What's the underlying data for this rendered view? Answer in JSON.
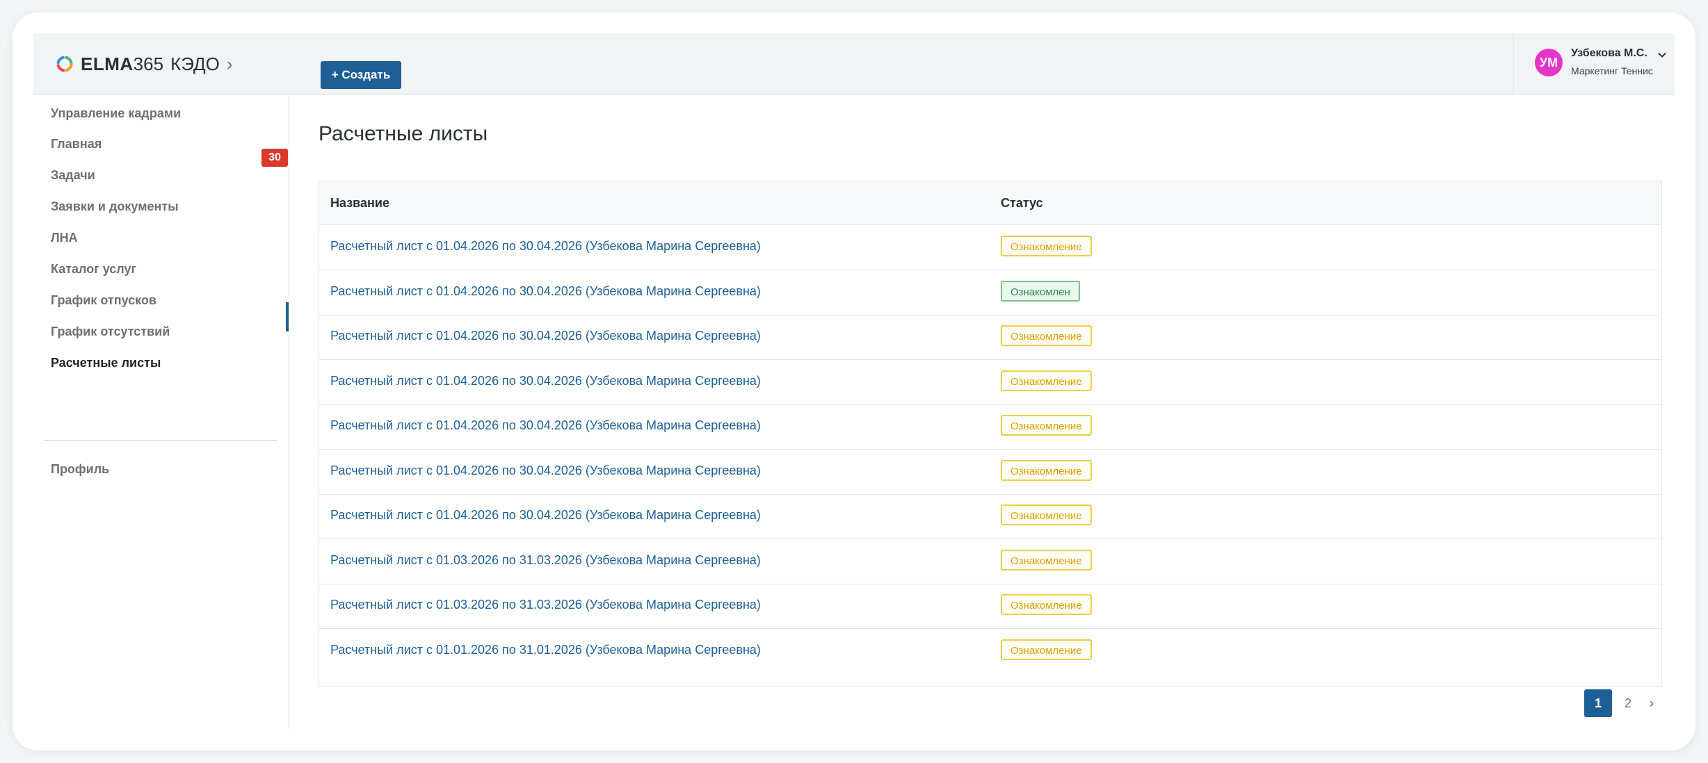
{
  "header": {
    "brand": "ELMA",
    "brand_number": "365",
    "product": "КЭДО",
    "create_label": "+ Создать",
    "user": {
      "initials": "УМ",
      "name": "Узбекова М.С.",
      "company": "Маркетинг Теннис",
      "avatar_color": "#e535c9"
    }
  },
  "sidebar": {
    "items": [
      {
        "label": "Управление кадрами"
      },
      {
        "label": "Главная"
      },
      {
        "label": "Задачи",
        "badge": "30"
      },
      {
        "label": "Заявки и документы"
      },
      {
        "label": "ЛНА"
      },
      {
        "label": "Каталог услуг"
      },
      {
        "label": "График отпусков"
      },
      {
        "label": "График отсутствий"
      },
      {
        "label": "Расчетные листы",
        "active": true
      }
    ],
    "profile_label": "Профиль"
  },
  "main": {
    "title": "Расчетные листы",
    "columns": [
      "Название",
      "Статус"
    ],
    "rows": [
      {
        "name": "Расчетный лист с 01.04.2026 по 30.04.2026 (Узбекова Марина Сергеевна)",
        "status": "Ознакомление",
        "status_type": "warn"
      },
      {
        "name": "Расчетный лист с 01.04.2026 по 30.04.2026 (Узбекова Марина Сергеевна)",
        "status": "Ознакомлен",
        "status_type": "ok"
      },
      {
        "name": "Расчетный лист с 01.04.2026 по 30.04.2026 (Узбекова Марина Сергеевна)",
        "status": "Ознакомление",
        "status_type": "warn"
      },
      {
        "name": "Расчетный лист с 01.04.2026 по 30.04.2026 (Узбекова Марина Сергеевна)",
        "status": "Ознакомление",
        "status_type": "warn"
      },
      {
        "name": "Расчетный лист с 01.04.2026 по 30.04.2026 (Узбекова Марина Сергеевна)",
        "status": "Ознакомление",
        "status_type": "warn"
      },
      {
        "name": "Расчетный лист с 01.04.2026 по 30.04.2026 (Узбекова Марина Сергеевна)",
        "status": "Ознакомление",
        "status_type": "warn"
      },
      {
        "name": "Расчетный лист с 01.04.2026 по 30.04.2026 (Узбекова Марина Сергеевна)",
        "status": "Ознакомление",
        "status_type": "warn"
      },
      {
        "name": "Расчетный лист с 01.03.2026 по 31.03.2026 (Узбекова Марина Сергеевна)",
        "status": "Ознакомление",
        "status_type": "warn"
      },
      {
        "name": "Расчетный лист с 01.03.2026 по 31.03.2026 (Узбекова Марина Сергеевна)",
        "status": "Ознакомление",
        "status_type": "warn"
      },
      {
        "name": "Расчетный лист с 01.01.2026 по 31.01.2026 (Узбекова Марина Сергеевна)",
        "status": "Ознакомление",
        "status_type": "warn"
      }
    ]
  },
  "pagination": {
    "current": "1",
    "pages": [
      "1",
      "2"
    ],
    "next_icon": "›"
  },
  "colors": {
    "accent": "#1e5f95",
    "badge": "#d93a2b",
    "status_warn": "#e0a000",
    "status_ok": "#2e8b57"
  }
}
